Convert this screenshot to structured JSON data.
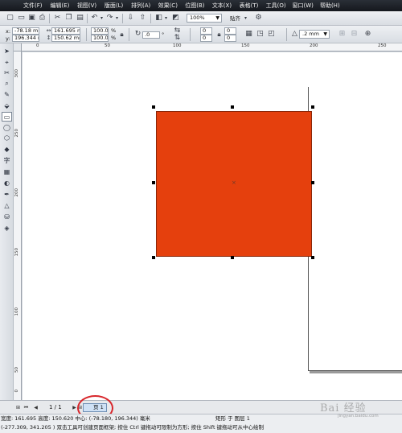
{
  "menu": [
    "文件(F)",
    "编辑(E)",
    "视图(V)",
    "版面(L)",
    "排列(A)",
    "效果(C)",
    "位图(B)",
    "文本(X)",
    "表格(T)",
    "工具(O)",
    "窗口(W)",
    "帮助(H)"
  ],
  "standard_toolbar": {
    "zoom_value": "100%",
    "snap_label": "贴齐",
    "icons": [
      "new-icon",
      "open-icon",
      "save-icon",
      "print-icon",
      "cut-icon",
      "copy-icon",
      "paste-icon",
      "undo-icon",
      "redo-icon",
      "import-icon",
      "export-icon",
      "app-launcher-icon",
      "welcome-icon",
      "zoom-dropdown",
      "snap-dropdown",
      "options-icon"
    ]
  },
  "property_bar": {
    "x_label": "x:",
    "x_value": "-78.18 mm",
    "y_label": "y:",
    "y_value": "196.344 mm",
    "width_value": "161.695 mm",
    "height_value": "150.62 mm",
    "scale_x": "100.0",
    "scale_y": "100.0",
    "percent": "%",
    "rotation_value": ".0",
    "corner_values": [
      "0",
      "0",
      "0",
      "0"
    ],
    "outline_value": ".2 mm"
  },
  "toolbox": [
    "pick-tool",
    "shape-tool",
    "crop-tool",
    "zoom-tool",
    "freehand-tool",
    "smart-fill-tool",
    "rectangle-tool",
    "ellipse-tool",
    "polygon-tool",
    "basic-shapes-tool",
    "text-tool",
    "table-tool",
    "interactive-blend-tool",
    "eyedropper-tool",
    "outline-tool",
    "fill-tool",
    "interactive-fill-tool"
  ],
  "ruler": {
    "top_labels": [
      "0",
      "50",
      "100",
      "150",
      "200",
      "250"
    ],
    "left_labels": [
      "300",
      "250",
      "200",
      "150",
      "100",
      "50",
      "0"
    ]
  },
  "colors": {
    "rectangle_fill": "#e5400d",
    "highlight_ring": "#d8262b"
  },
  "page_nav": {
    "counter": "1 / 1",
    "tab_label": "页 1"
  },
  "status": {
    "line1_dims": "宽度: 161.695  高度: 150.620  中心: (-78.180, 196.344)  毫米",
    "line1_object": "矩形 于 图层 1",
    "line2": "(-277.309, 341.205 )   双击工具可创建页面框架; 按住 Ctrl 键拖动可限制为方形; 按住 Shift 键拖动可从中心绘制"
  },
  "watermark": {
    "text": "Bai 经验",
    "url": "jingyan.baidu.com"
  }
}
